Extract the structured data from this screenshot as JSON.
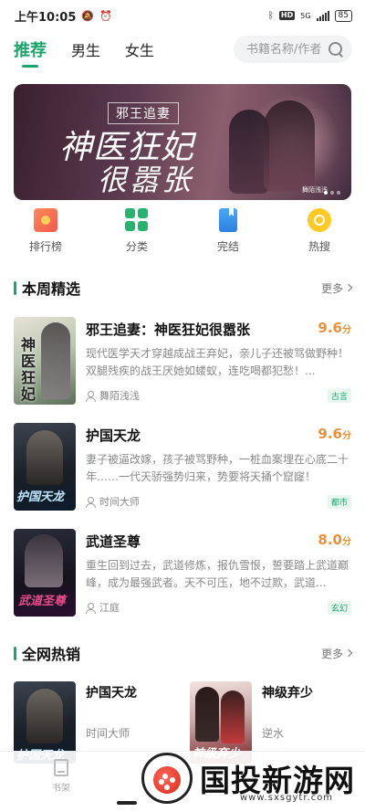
{
  "status_bar": {
    "time": "上午10:05",
    "network": "5G",
    "battery": "85"
  },
  "tabs": [
    {
      "label": "推荐",
      "active": true
    },
    {
      "label": "男生",
      "active": false
    },
    {
      "label": "女生",
      "active": false
    }
  ],
  "search": {
    "placeholder": "书籍名称/作者"
  },
  "banner": {
    "subtitle": "邪王追妻",
    "title_line1": "神医狂妃",
    "title_line2": "很嚣张",
    "author": "舞陌浅浅"
  },
  "quick_nav": [
    {
      "label": "排行榜",
      "icon": "ranking-icon"
    },
    {
      "label": "分类",
      "icon": "category-grid-icon"
    },
    {
      "label": "完结",
      "icon": "bookmark-book-icon"
    },
    {
      "label": "热搜",
      "icon": "hot-search-icon"
    }
  ],
  "weekly": {
    "title": "本周精选",
    "more": "更多",
    "books": [
      {
        "title": "邪王追妻：神医狂妃很嚣张",
        "score": "9.6",
        "score_unit": "分",
        "desc": "现代医学天才穿越成战王弃妃，亲儿子还被骂做野种！双腿残疾的战王厌她如蝼蚁，连吃喝都犯愁！...",
        "author": "舞陌浅浅",
        "tag": "古言",
        "cover_text": "神医狂妃"
      },
      {
        "title": "护国天龙",
        "score": "9.6",
        "score_unit": "分",
        "desc": "妻子被逼改嫁，孩子被骂野种，一桩血案埋在心底二十年……一代天骄强势归来，势要将天捅个窟窿！",
        "author": "时间大师",
        "tag": "都市",
        "cover_text": "护国天龙"
      },
      {
        "title": "武道圣尊",
        "score": "8.0",
        "score_unit": "分",
        "desc": "重生回到过去，武道修炼，报仇雪恨，誓要踏上武道巅峰，成为最强武者。天不可压，地不过欺，武道...",
        "author": "江庭",
        "tag": "玄幻",
        "cover_text": "武道圣尊"
      }
    ]
  },
  "hot": {
    "title": "全网热销",
    "more": "更多",
    "books": [
      {
        "title": "护国天龙",
        "author": "时间大师",
        "cover_text": "护国天龙"
      },
      {
        "title": "神级弃少",
        "author": "逆水",
        "cover_text": "神级弃少"
      }
    ]
  },
  "bottom_nav": {
    "shelf_label": "书架"
  },
  "watermark": {
    "text": "国投新游网",
    "url": "www.sxsgytr.com"
  },
  "colors": {
    "accent": "#1aa56a",
    "score": "#e8913a"
  }
}
